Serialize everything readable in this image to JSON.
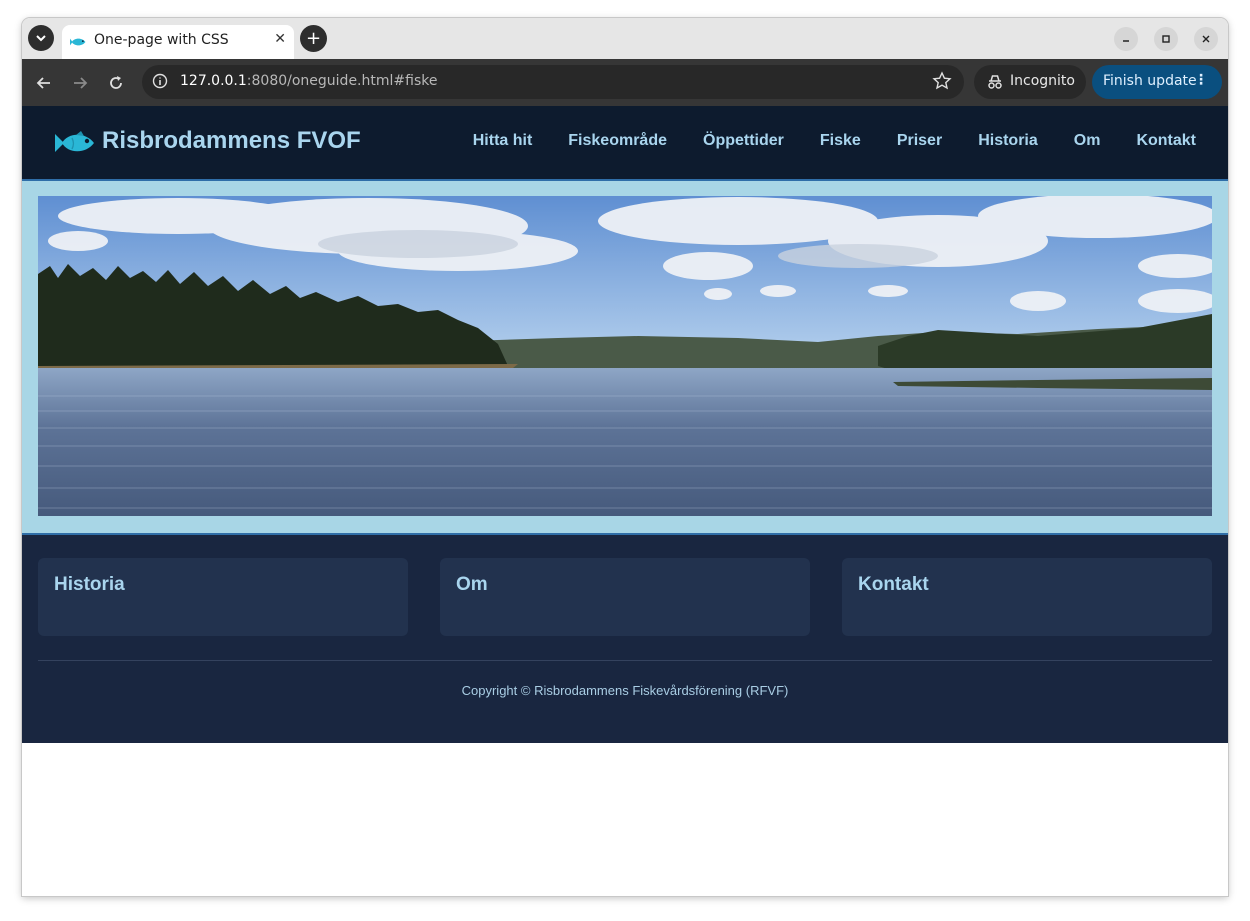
{
  "browser": {
    "tab_title": "One-page with CSS",
    "url_host": "127.0.0.1",
    "url_rest": ":8080/oneguide.html#fiske",
    "incognito_label": "Incognito",
    "update_label": "Finish update"
  },
  "site": {
    "title": "Risbrodammens FVOF",
    "nav": [
      "Hitta hit",
      "Fiskeområde",
      "Öppettider",
      "Fiske",
      "Priser",
      "Historia",
      "Om",
      "Kontakt"
    ]
  },
  "footer": {
    "cards": [
      "Historia",
      "Om",
      "Kontakt"
    ],
    "copyright": "Copyright © Risbrodammens Fiskevårdsförening (RFVF)"
  },
  "colors": {
    "header_bg": "#0d1b2e",
    "accent_text": "#a9d5ee",
    "hero_band": "#a8d6e6",
    "footer_bg": "#192640",
    "card_bg": "#22324e",
    "fish": "#2ab7d6"
  }
}
